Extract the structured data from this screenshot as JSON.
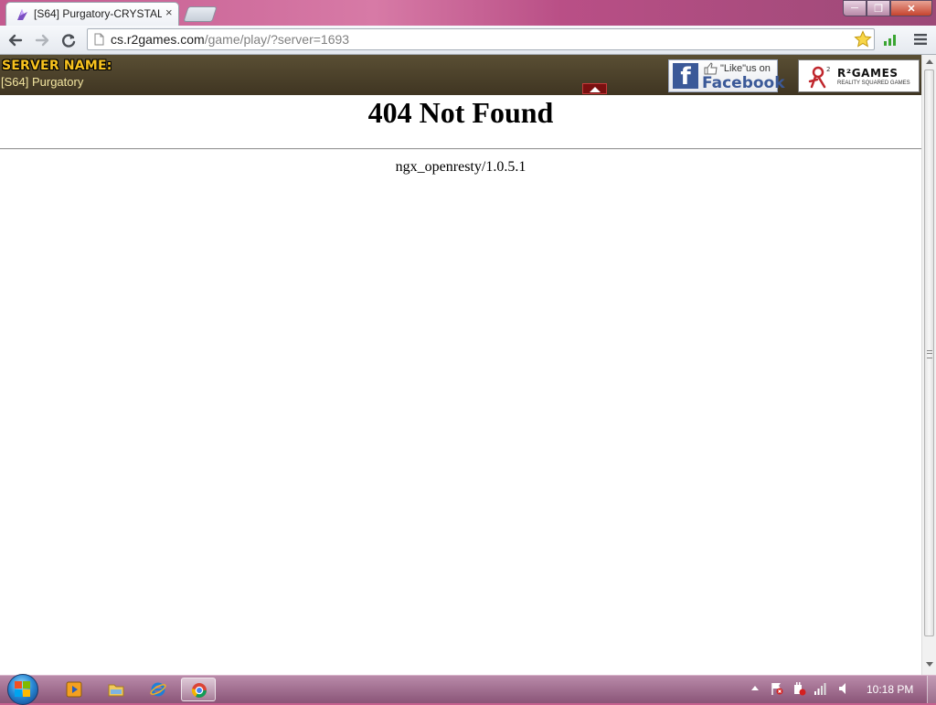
{
  "browser": {
    "tab_title": "[S64] Purgatory-CRYSTAL",
    "tab_close": "×",
    "url_host": "cs.r2games.com",
    "url_path": "/game/play/?server=1693",
    "window_controls": {
      "minimize": "─",
      "maximize": "❐",
      "close": "✕"
    }
  },
  "game_bar": {
    "server_label": "SERVER NAME:",
    "server_name": "[S64] Purgatory",
    "facebook": {
      "like_text": "\"Like\"us on",
      "name": "Facebook",
      "logo_letter": "f"
    },
    "r2games": {
      "name": "R²GAMES",
      "tagline": "REALITY SQUARED GAMES"
    },
    "colors": {
      "bar_dark": "#3f3522",
      "label_gold": "#f7c21e",
      "facebook_blue": "#3b5998"
    }
  },
  "error_page": {
    "title": "404 Not Found",
    "server": "ngx_openresty/1.0.5.1"
  },
  "taskbar": {
    "clock": "10:18 PM",
    "pinned": [
      "media-player-icon",
      "explorer-folder-icon",
      "internet-explorer-icon",
      "chrome-icon"
    ],
    "tray": [
      "show-hidden-icons-arrow",
      "action-center-flag-icon",
      "power-icon",
      "network-signal-icon",
      "volume-icon"
    ]
  }
}
